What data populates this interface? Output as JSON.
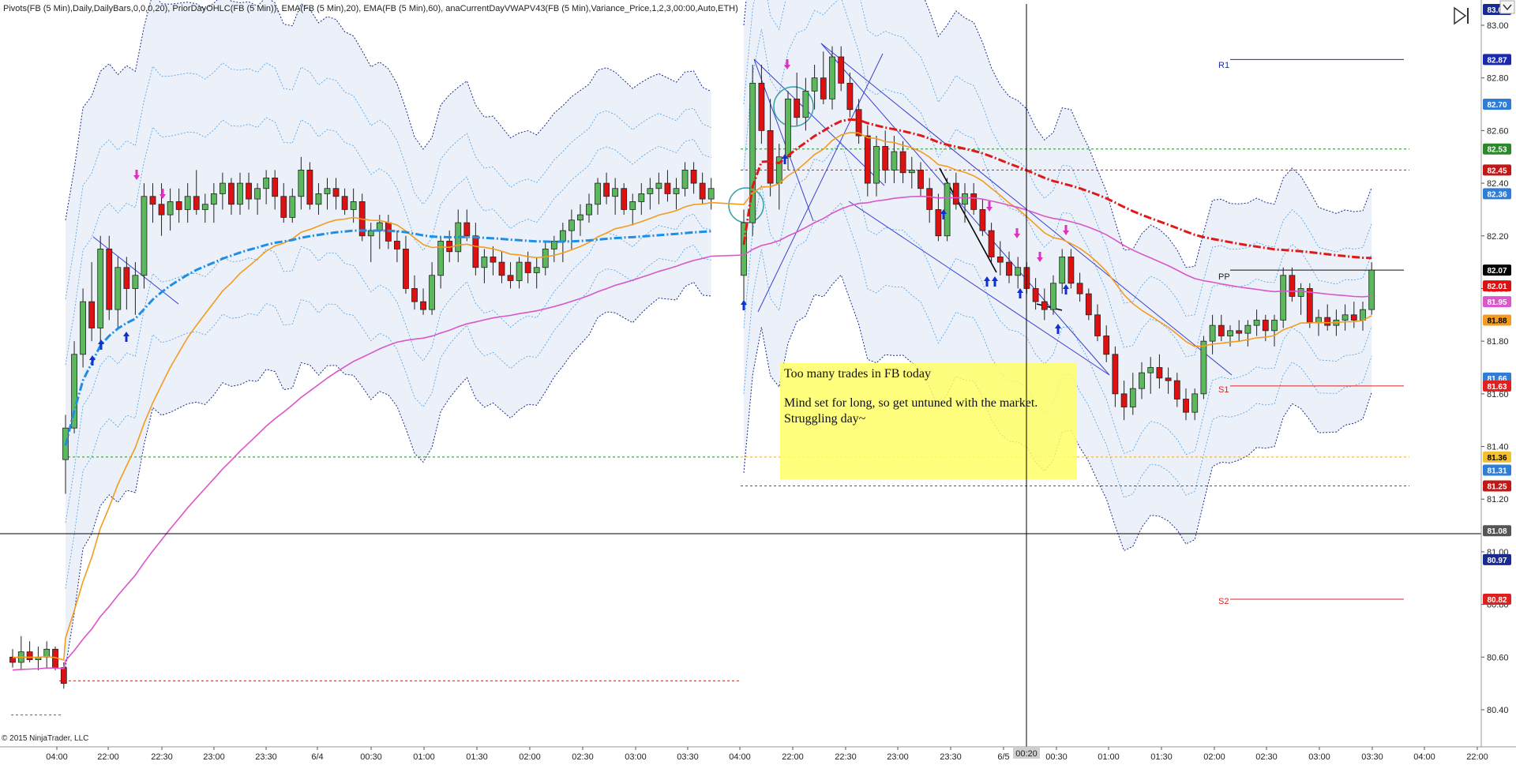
{
  "header": {
    "indicators": "Pivots(FB (5 Min),Daily,DailyBars,0,0,0,20), PriorDayOHLC(FB (5 Min)), EMA(FB (5 Min),20), EMA(FB (5 Min),60), anaCurrentDayVWAPV43(FB (5 Min),Variance_Price,1,2,3,00:00,Auto,ETH)"
  },
  "copyright": "© 2015 NinjaTrader, LLC",
  "note": {
    "line1": "Too many trades in FB today",
    "line2": "Mind set for long, so get untuned with the market.",
    "line3": "Struggling day~"
  },
  "pivots": {
    "r1": "R1",
    "pp": "PP",
    "s1": "S1",
    "s2": "S2"
  },
  "colors": {
    "bull": "#5cb85c",
    "bear": "#dd1111",
    "ema20": "#f39c1f",
    "ema60": "#d957c8",
    "vwap": "#1e8fe6",
    "band_fill": "#e9eef8",
    "pivot_line": "#1a2ab0",
    "s_line": "#e02020"
  },
  "chart_data": {
    "type": "candlestick",
    "ylim": [
      80.3,
      83.1
    ],
    "y_ticks": [
      "83.00",
      "82.80",
      "82.60",
      "82.40",
      "82.20",
      "82.00",
      "81.80",
      "81.60",
      "81.40",
      "81.20",
      "81.00",
      "80.80",
      "80.60",
      "80.40"
    ],
    "x_ticks": [
      "04:00",
      "22:00",
      "22:30",
      "23:00",
      "23:30",
      "6/4",
      "00:30",
      "01:00",
      "01:30",
      "02:00",
      "02:30",
      "03:00",
      "03:30",
      "04:00",
      "22:00",
      "22:30",
      "23:00",
      "23:30",
      "6/5",
      "00:30",
      "01:00",
      "01:30",
      "02:00",
      "02:30",
      "03:00",
      "03:30",
      "04:00",
      "22:00"
    ],
    "crosshair_time": "00:20",
    "crosshair_price": "81.08",
    "price_labels": [
      {
        "text": "83.00",
        "value": 83.06,
        "bg": "#1a2a90",
        "fg": "#ffffff"
      },
      {
        "text": "82.87",
        "value": 82.87,
        "bg": "#1a2ab0",
        "fg": "#ffffff"
      },
      {
        "text": "82.70",
        "value": 82.7,
        "bg": "#2e7dd6",
        "fg": "#ffffff"
      },
      {
        "text": "82.53",
        "value": 82.53,
        "bg": "#2a8a2a",
        "fg": "#ffffff"
      },
      {
        "text": "82.45",
        "value": 82.45,
        "bg": "#c01818",
        "fg": "#ffffff"
      },
      {
        "text": "82.36",
        "value": 82.36,
        "bg": "#2e7dd6",
        "fg": "#ffffff"
      },
      {
        "text": "82.07",
        "value": 82.07,
        "bg": "#000000",
        "fg": "#ffffff"
      },
      {
        "text": "82.01",
        "value": 82.01,
        "bg": "#dd1111",
        "fg": "#ffffff"
      },
      {
        "text": "81.95",
        "value": 81.95,
        "bg": "#d957c8",
        "fg": "#ffffff"
      },
      {
        "text": "81.88",
        "value": 81.88,
        "bg": "#f39c1f",
        "fg": "#000000"
      },
      {
        "text": "81.66",
        "value": 81.66,
        "bg": "#2e7dd6",
        "fg": "#ffffff"
      },
      {
        "text": "81.63",
        "value": 81.63,
        "bg": "#e02020",
        "fg": "#ffffff"
      },
      {
        "text": "81.36",
        "value": 81.36,
        "bg": "#f2c12e",
        "fg": "#000000"
      },
      {
        "text": "81.31",
        "value": 81.31,
        "bg": "#2e7dd6",
        "fg": "#ffffff"
      },
      {
        "text": "81.25",
        "value": 81.25,
        "bg": "#c01818",
        "fg": "#ffffff"
      },
      {
        "text": "81.08",
        "value": 81.08,
        "bg": "#555555",
        "fg": "#ffffff"
      },
      {
        "text": "80.97",
        "value": 80.97,
        "bg": "#1a2a90",
        "fg": "#ffffff"
      },
      {
        "text": "80.82",
        "value": 80.82,
        "bg": "#e02020",
        "fg": "#ffffff"
      }
    ],
    "candles": [
      [
        80.6,
        80.63,
        80.56,
        80.58
      ],
      [
        80.58,
        80.68,
        80.55,
        80.62
      ],
      [
        80.62,
        80.66,
        80.58,
        80.59
      ],
      [
        80.59,
        80.64,
        80.55,
        80.6
      ],
      [
        80.6,
        80.66,
        80.56,
        80.63
      ],
      [
        80.63,
        80.64,
        80.55,
        80.56
      ],
      [
        80.56,
        80.58,
        80.48,
        80.5
      ],
      [
        81.35,
        81.52,
        81.22,
        81.47
      ],
      [
        81.47,
        81.8,
        81.45,
        81.75
      ],
      [
        81.75,
        82.0,
        81.7,
        81.95
      ],
      [
        81.95,
        82.1,
        81.8,
        81.85
      ],
      [
        81.85,
        82.2,
        81.8,
        82.15
      ],
      [
        82.15,
        82.2,
        81.88,
        81.92
      ],
      [
        81.92,
        82.12,
        81.85,
        82.08
      ],
      [
        82.08,
        82.12,
        81.92,
        82.0
      ],
      [
        82.0,
        82.1,
        81.9,
        82.05
      ],
      [
        82.05,
        82.4,
        82.0,
        82.35
      ],
      [
        82.35,
        82.4,
        82.25,
        82.32
      ],
      [
        82.32,
        82.4,
        82.2,
        82.28
      ],
      [
        82.28,
        82.38,
        82.22,
        82.33
      ],
      [
        82.33,
        82.38,
        82.25,
        82.3
      ],
      [
        82.3,
        82.4,
        82.25,
        82.35
      ],
      [
        82.35,
        82.45,
        82.28,
        82.3
      ],
      [
        82.3,
        82.36,
        82.25,
        82.32
      ],
      [
        82.32,
        82.4,
        82.25,
        82.36
      ],
      [
        82.36,
        82.44,
        82.3,
        82.4
      ],
      [
        82.4,
        82.42,
        82.28,
        82.32
      ],
      [
        82.32,
        82.44,
        82.28,
        82.4
      ],
      [
        82.4,
        82.44,
        82.3,
        82.34
      ],
      [
        82.34,
        82.4,
        82.28,
        82.38
      ],
      [
        82.38,
        82.45,
        82.32,
        82.42
      ],
      [
        82.42,
        82.45,
        82.3,
        82.35
      ],
      [
        82.35,
        82.4,
        82.25,
        82.27
      ],
      [
        82.27,
        82.38,
        82.25,
        82.35
      ],
      [
        82.35,
        82.5,
        82.3,
        82.45
      ],
      [
        82.45,
        82.48,
        82.3,
        82.32
      ],
      [
        82.32,
        82.4,
        82.28,
        82.36
      ],
      [
        82.36,
        82.42,
        82.3,
        82.38
      ],
      [
        82.38,
        82.42,
        82.3,
        82.35
      ],
      [
        82.35,
        82.38,
        82.28,
        82.3
      ],
      [
        82.3,
        82.38,
        82.25,
        82.33
      ],
      [
        82.33,
        82.36,
        82.18,
        82.2
      ],
      [
        82.2,
        82.25,
        82.1,
        82.22
      ],
      [
        82.22,
        82.28,
        82.15,
        82.25
      ],
      [
        82.25,
        82.28,
        82.15,
        82.18
      ],
      [
        82.18,
        82.22,
        82.1,
        82.15
      ],
      [
        82.15,
        82.2,
        81.98,
        82.0
      ],
      [
        82.0,
        82.05,
        81.92,
        81.95
      ],
      [
        81.95,
        82.0,
        81.9,
        81.92
      ],
      [
        81.92,
        82.1,
        81.9,
        82.05
      ],
      [
        82.05,
        82.2,
        82.0,
        82.18
      ],
      [
        82.18,
        82.22,
        82.1,
        82.14
      ],
      [
        82.14,
        82.3,
        82.1,
        82.25
      ],
      [
        82.25,
        82.3,
        82.18,
        82.2
      ],
      [
        82.2,
        82.25,
        82.05,
        82.08
      ],
      [
        82.08,
        82.15,
        82.02,
        82.12
      ],
      [
        82.12,
        82.16,
        82.05,
        82.1
      ],
      [
        82.1,
        82.14,
        82.02,
        82.05
      ],
      [
        82.05,
        82.1,
        82.0,
        82.03
      ],
      [
        82.03,
        82.12,
        82.0,
        82.1
      ],
      [
        82.1,
        82.14,
        82.02,
        82.06
      ],
      [
        82.06,
        82.12,
        82.0,
        82.08
      ],
      [
        82.08,
        82.18,
        82.05,
        82.15
      ],
      [
        82.15,
        82.2,
        82.1,
        82.18
      ],
      [
        82.18,
        82.25,
        82.1,
        82.22
      ],
      [
        82.22,
        82.3,
        82.15,
        82.26
      ],
      [
        82.26,
        82.32,
        82.2,
        82.28
      ],
      [
        82.28,
        82.36,
        82.25,
        82.32
      ],
      [
        82.32,
        82.42,
        82.28,
        82.4
      ],
      [
        82.4,
        82.44,
        82.32,
        82.35
      ],
      [
        82.35,
        82.42,
        82.28,
        82.38
      ],
      [
        82.38,
        82.4,
        82.28,
        82.3
      ],
      [
        82.3,
        82.36,
        82.24,
        82.33
      ],
      [
        82.33,
        82.4,
        82.28,
        82.36
      ],
      [
        82.36,
        82.42,
        82.3,
        82.38
      ],
      [
        82.38,
        82.44,
        82.32,
        82.4
      ],
      [
        82.4,
        82.45,
        82.33,
        82.36
      ],
      [
        82.36,
        82.42,
        82.3,
        82.38
      ],
      [
        82.38,
        82.48,
        82.35,
        82.45
      ],
      [
        82.45,
        82.48,
        82.36,
        82.4
      ],
      [
        82.4,
        82.44,
        82.32,
        82.34
      ],
      [
        82.34,
        82.42,
        82.3,
        82.38
      ],
      [
        82.05,
        82.3,
        81.95,
        82.25
      ],
      [
        82.25,
        82.85,
        82.2,
        82.78
      ],
      [
        82.78,
        82.85,
        82.55,
        82.6
      ],
      [
        82.6,
        82.72,
        82.35,
        82.4
      ],
      [
        82.4,
        82.55,
        82.3,
        82.5
      ],
      [
        82.5,
        82.75,
        82.45,
        82.72
      ],
      [
        82.72,
        82.82,
        82.62,
        82.65
      ],
      [
        82.65,
        82.8,
        82.6,
        82.75
      ],
      [
        82.75,
        82.85,
        82.68,
        82.8
      ],
      [
        82.8,
        82.9,
        82.7,
        82.72
      ],
      [
        82.72,
        82.92,
        82.68,
        82.88
      ],
      [
        82.88,
        82.92,
        82.75,
        82.78
      ],
      [
        82.78,
        82.82,
        82.65,
        82.68
      ],
      [
        82.68,
        82.72,
        82.55,
        82.58
      ],
      [
        82.58,
        82.62,
        82.35,
        82.4
      ],
      [
        82.4,
        82.58,
        82.35,
        82.54
      ],
      [
        82.54,
        82.6,
        82.4,
        82.45
      ],
      [
        82.45,
        82.58,
        82.4,
        82.52
      ],
      [
        82.52,
        82.56,
        82.4,
        82.44
      ],
      [
        82.44,
        82.5,
        82.38,
        82.45
      ],
      [
        82.45,
        82.48,
        82.35,
        82.38
      ],
      [
        82.38,
        82.42,
        82.25,
        82.3
      ],
      [
        82.3,
        82.36,
        82.18,
        82.2
      ],
      [
        82.2,
        82.42,
        82.18,
        82.4
      ],
      [
        82.4,
        82.44,
        82.3,
        82.32
      ],
      [
        82.32,
        82.4,
        82.25,
        82.36
      ],
      [
        82.36,
        82.4,
        82.28,
        82.3
      ],
      [
        82.3,
        82.34,
        82.2,
        82.22
      ],
      [
        82.22,
        82.25,
        82.1,
        82.12
      ],
      [
        82.12,
        82.18,
        82.05,
        82.1
      ],
      [
        82.1,
        82.14,
        82.02,
        82.05
      ],
      [
        82.05,
        82.12,
        82.0,
        82.08
      ],
      [
        82.08,
        82.1,
        81.98,
        82.0
      ],
      [
        82.0,
        82.04,
        81.92,
        81.95
      ],
      [
        81.95,
        82.0,
        81.88,
        81.92
      ],
      [
        81.92,
        82.05,
        81.9,
        82.02
      ],
      [
        82.02,
        82.15,
        81.98,
        82.12
      ],
      [
        82.12,
        82.15,
        82.0,
        82.02
      ],
      [
        82.02,
        82.06,
        81.95,
        81.98
      ],
      [
        81.98,
        82.0,
        81.88,
        81.9
      ],
      [
        81.9,
        81.94,
        81.8,
        81.82
      ],
      [
        81.82,
        81.86,
        81.72,
        81.75
      ],
      [
        81.75,
        81.78,
        81.55,
        81.6
      ],
      [
        81.6,
        81.65,
        81.5,
        81.55
      ],
      [
        81.55,
        81.68,
        81.52,
        81.62
      ],
      [
        81.62,
        81.72,
        81.58,
        81.68
      ],
      [
        81.68,
        81.74,
        81.6,
        81.7
      ],
      [
        81.7,
        81.75,
        81.62,
        81.66
      ],
      [
        81.66,
        81.7,
        81.6,
        81.65
      ],
      [
        81.65,
        81.68,
        81.55,
        81.58
      ],
      [
        81.58,
        81.62,
        81.5,
        81.53
      ],
      [
        81.53,
        81.62,
        81.5,
        81.6
      ],
      [
        81.6,
        81.82,
        81.58,
        81.8
      ],
      [
        81.8,
        81.9,
        81.75,
        81.86
      ],
      [
        81.86,
        81.9,
        81.8,
        81.82
      ],
      [
        81.82,
        81.86,
        81.78,
        81.84
      ],
      [
        81.84,
        81.88,
        81.8,
        81.83
      ],
      [
        81.83,
        81.88,
        81.78,
        81.86
      ],
      [
        81.86,
        81.92,
        81.82,
        81.88
      ],
      [
        81.88,
        81.9,
        81.8,
        81.84
      ],
      [
        81.84,
        81.9,
        81.78,
        81.88
      ],
      [
        81.88,
        82.08,
        81.85,
        82.05
      ],
      [
        82.05,
        82.08,
        81.95,
        81.97
      ],
      [
        81.97,
        82.02,
        81.9,
        82.0
      ],
      [
        82.0,
        82.02,
        81.85,
        81.87
      ],
      [
        81.87,
        81.92,
        81.82,
        81.89
      ],
      [
        81.89,
        81.94,
        81.84,
        81.86
      ],
      [
        81.86,
        81.92,
        81.82,
        81.88
      ],
      [
        81.88,
        81.94,
        81.84,
        81.9
      ],
      [
        81.9,
        81.95,
        81.85,
        81.88
      ],
      [
        81.88,
        81.95,
        81.84,
        81.92
      ],
      [
        81.92,
        82.1,
        81.9,
        82.07
      ]
    ]
  }
}
